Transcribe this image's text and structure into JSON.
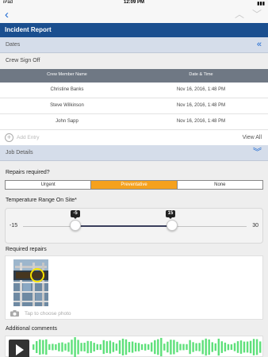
{
  "status_bar": {
    "carrier": "iPad",
    "time": "12:09 PM",
    "battery": "▮▮▮"
  },
  "nav": {
    "back_icon": "chevron-left-icon",
    "up_icon": "chevron-up-icon",
    "down_icon": "chevron-down-icon"
  },
  "title": "Incident Report",
  "sections": {
    "dates": "Dates",
    "crew_signoff": "Crew Sign Off",
    "job_details": "Job Details"
  },
  "crew_table": {
    "columns": [
      "Crew Member Name",
      "Date & Time"
    ],
    "rows": [
      {
        "name": "Christine Banks",
        "date": "Nov 16, 2016, 1:48 PM"
      },
      {
        "name": "Steve Wilkinson",
        "date": "Nov 16, 2016, 1:48 PM"
      },
      {
        "name": "John Sapp",
        "date": "Nov 16, 2016, 1:48 PM"
      }
    ],
    "add_entry": "Add Entry",
    "view_all": "View All"
  },
  "repairs": {
    "label": "Repairs required?",
    "options": [
      "Urgent",
      "Preventative",
      "None"
    ],
    "selected": "Preventative"
  },
  "temperature": {
    "label": "Temperature Range On Site*",
    "min": "-15",
    "max": "30",
    "low_value": "-5",
    "high_value": "15"
  },
  "photos": {
    "label": "Required repairs",
    "hint": "Tap to choose photo"
  },
  "comments": {
    "label": "Additional comments"
  },
  "colors": {
    "title_bar": "#1b4f8f",
    "accent": "#f5a11d",
    "link": "#1a67d2"
  }
}
